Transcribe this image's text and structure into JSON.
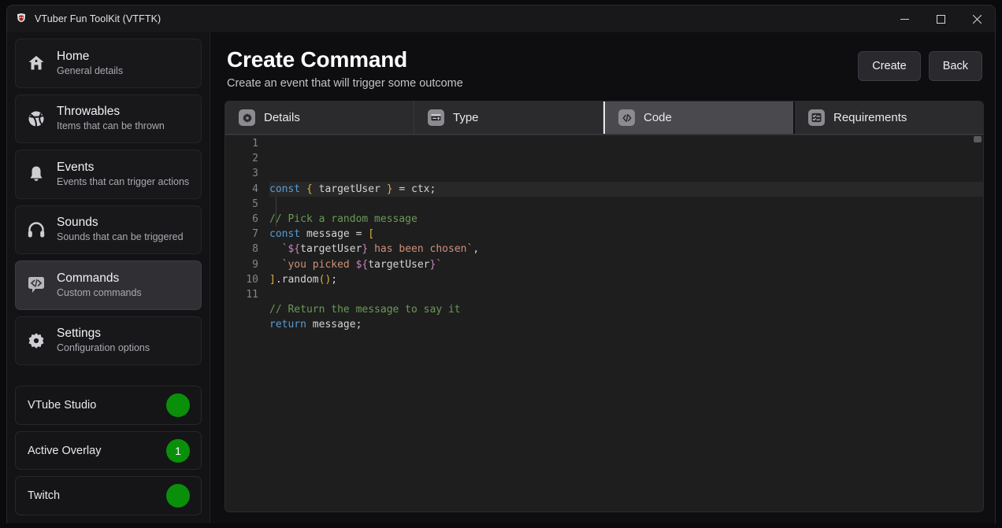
{
  "window": {
    "title": "VTuber Fun ToolKit (VTFTK)",
    "app_icon": "vtftk-logo-icon",
    "controls": {
      "minimize": "minimize-icon",
      "maximize": "maximize-icon",
      "close": "close-icon"
    }
  },
  "sidebar": {
    "items": [
      {
        "label": "Home",
        "sub": "General details",
        "icon": "house-icon",
        "active": false
      },
      {
        "label": "Throwables",
        "sub": "Items that can be thrown",
        "icon": "ball-icon",
        "active": false
      },
      {
        "label": "Events",
        "sub": "Events that can trigger actions",
        "icon": "bell-icon",
        "active": false
      },
      {
        "label": "Sounds",
        "sub": "Sounds that can be triggered",
        "icon": "headphones-icon",
        "active": false
      },
      {
        "label": "Commands",
        "sub": "Custom commands",
        "icon": "code-bubble-icon",
        "active": true
      },
      {
        "label": "Settings",
        "sub": "Configuration options",
        "icon": "gear-icon",
        "active": false
      }
    ],
    "status": [
      {
        "label": "VTube Studio",
        "badge": "",
        "color": "#0a8f0a"
      },
      {
        "label": "Active Overlay",
        "badge": "1",
        "color": "#0a8f0a"
      },
      {
        "label": "Twitch",
        "badge": "",
        "color": "#0a8f0a"
      }
    ]
  },
  "header": {
    "title": "Create Command",
    "subtitle": "Create an event that will trigger some outcome",
    "create_label": "Create",
    "back_label": "Back"
  },
  "tabs": [
    {
      "label": "Details",
      "icon": "gear-icon",
      "active": false
    },
    {
      "label": "Type",
      "icon": "input-card-icon",
      "active": false
    },
    {
      "label": "Code",
      "icon": "code-icon",
      "active": true
    },
    {
      "label": "Requirements",
      "icon": "checklist-icon",
      "active": false
    }
  ],
  "editor": {
    "line_numbers": [
      "1",
      "2",
      "3",
      "4",
      "5",
      "6",
      "7",
      "8",
      "9",
      "10",
      "11"
    ],
    "lines": [
      {
        "n": "1",
        "tokens": [
          {
            "t": "const",
            "c": "kw"
          },
          {
            "t": " ",
            "c": "plain"
          },
          {
            "t": "{",
            "c": "br-y"
          },
          {
            "t": " targetUser ",
            "c": "plain"
          },
          {
            "t": "}",
            "c": "br-y"
          },
          {
            "t": " = ctx;",
            "c": "plain"
          }
        ]
      },
      {
        "n": "2",
        "tokens": []
      },
      {
        "n": "3",
        "tokens": [
          {
            "t": "// Pick a random message",
            "c": "cmt"
          }
        ]
      },
      {
        "n": "4",
        "tokens": [
          {
            "t": "const",
            "c": "kw"
          },
          {
            "t": " message = ",
            "c": "plain"
          },
          {
            "t": "[",
            "c": "br-y"
          }
        ]
      },
      {
        "n": "5",
        "tokens": [
          {
            "t": "  ",
            "c": "plain"
          },
          {
            "t": "`",
            "c": "str"
          },
          {
            "t": "${",
            "c": "tpl"
          },
          {
            "t": "targetUser",
            "c": "plain"
          },
          {
            "t": "}",
            "c": "tpl"
          },
          {
            "t": " has been chosen",
            "c": "str"
          },
          {
            "t": "`",
            "c": "str"
          },
          {
            "t": ",",
            "c": "plain"
          }
        ]
      },
      {
        "n": "6",
        "tokens": [
          {
            "t": "  ",
            "c": "plain"
          },
          {
            "t": "`you picked ",
            "c": "str"
          },
          {
            "t": "${",
            "c": "tpl"
          },
          {
            "t": "targetUser",
            "c": "plain"
          },
          {
            "t": "}",
            "c": "tpl"
          },
          {
            "t": "`",
            "c": "str"
          }
        ]
      },
      {
        "n": "7",
        "tokens": [
          {
            "t": "]",
            "c": "br-y"
          },
          {
            "t": ".random",
            "c": "plain"
          },
          {
            "t": "()",
            "c": "br-y"
          },
          {
            "t": ";",
            "c": "plain"
          }
        ]
      },
      {
        "n": "8",
        "tokens": []
      },
      {
        "n": "9",
        "tokens": [
          {
            "t": "// Return the message to say it",
            "c": "cmt"
          }
        ]
      },
      {
        "n": "10",
        "tokens": [
          {
            "t": "return",
            "c": "kw"
          },
          {
            "t": " message;",
            "c": "plain"
          }
        ]
      },
      {
        "n": "11",
        "tokens": []
      }
    ]
  },
  "colors": {
    "accent_green": "#0a8f0a",
    "editor_bg": "#1e1e1e",
    "window_bg": "#111113",
    "keyword": "#569cd6",
    "comment": "#6a9955",
    "string": "#ce9178",
    "bracket": "#ddb13a",
    "template": "#c586c0"
  }
}
